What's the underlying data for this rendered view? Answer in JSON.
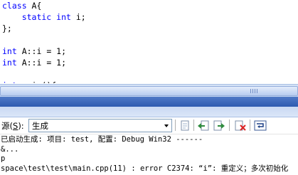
{
  "editor": {
    "lines": [
      [
        {
          "t": "class",
          "k": true
        },
        {
          "t": " A{",
          "k": false
        }
      ],
      [
        {
          "t": "    static int",
          "k": true
        },
        {
          "t": " i;",
          "k": false
        }
      ],
      [
        {
          "t": "};",
          "k": false
        }
      ],
      [],
      [
        {
          "t": "int",
          "k": true
        },
        {
          "t": " A::i = 1;",
          "k": false
        }
      ],
      [
        {
          "t": "int",
          "k": true
        },
        {
          "t": " A::i = 1;",
          "k": false
        }
      ],
      [],
      [
        {
          "t": "int",
          "k": true
        },
        {
          "t": " main(){",
          "k": false
        }
      ]
    ]
  },
  "output_pane": {
    "source_label_prefix": "源(",
    "source_label_key": "S",
    "source_label_suffix": "):",
    "source_value": "生成",
    "lines": [
      "已启动生成: 项目: test, 配置: Debug Win32 ------",
      "&...",
      "p",
      "space\\test\\test\\main.cpp(11) : error C2374: “i”: 重定义；多次初始化"
    ]
  },
  "toolbar_icons": [
    "goto-location-icon",
    "previous-message-icon",
    "next-message-icon",
    "clear-all-icon",
    "word-wrap-icon"
  ]
}
